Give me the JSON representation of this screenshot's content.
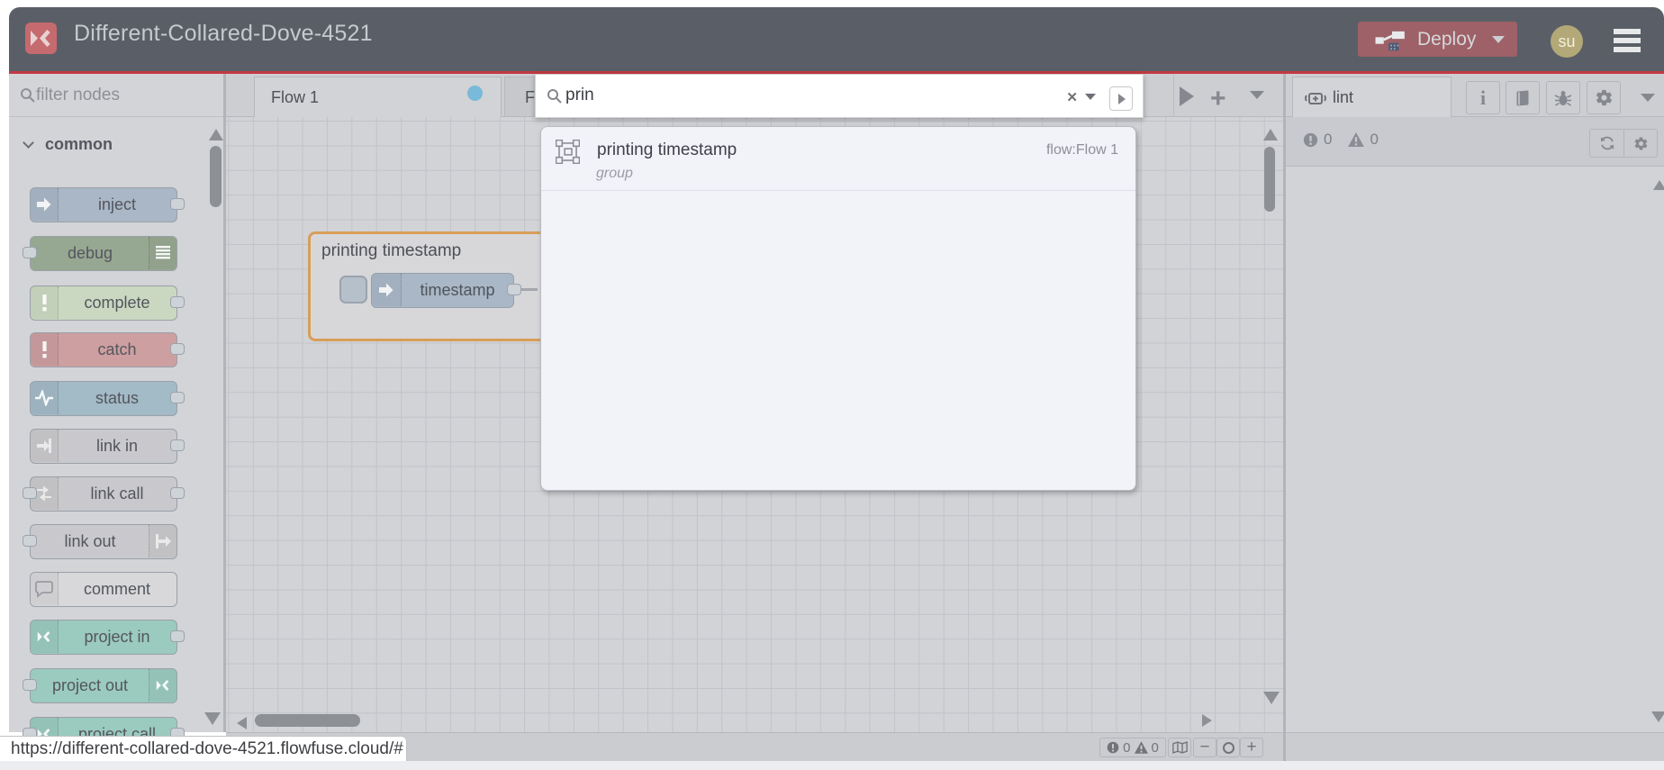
{
  "colors": {
    "header_bg": "#5a5f67",
    "accent_red": "#c23b42",
    "brand_red": "#c56a6e",
    "deploy_bg": "#9d6167",
    "dirty_dot": "#79b9d9",
    "group_border": "#d89e58"
  },
  "header": {
    "title": "Different-Collared-Dove-4521",
    "deploy_label": "Deploy",
    "avatar_initials": "su"
  },
  "workspace": {
    "tab1_label": "Flow 1",
    "tab2_label": "Fl"
  },
  "palette": {
    "filter_placeholder": "filter nodes",
    "category": "common",
    "nodes": [
      {
        "label": "inject",
        "color": "#a9b7c6",
        "icon": "inject-icon",
        "iconSide": "l",
        "ports": "r"
      },
      {
        "label": "debug",
        "color": "#97a892",
        "icon": "debug-icon",
        "iconSide": "r",
        "ports": "l"
      },
      {
        "label": "complete",
        "color": "#cad8c1",
        "icon": "exclamation-icon",
        "iconSide": "l",
        "ports": "r"
      },
      {
        "label": "catch",
        "color": "#cd9fa1",
        "icon": "exclamation-icon",
        "iconSide": "l",
        "ports": "r"
      },
      {
        "label": "status",
        "color": "#a3bac7",
        "icon": "status-icon",
        "iconSide": "l",
        "ports": "r"
      },
      {
        "label": "link in",
        "color": "#c9c9cd",
        "icon": "link-in-icon",
        "iconSide": "l",
        "ports": "r"
      },
      {
        "label": "link call",
        "color": "#c9c9cd",
        "icon": "link-call-icon",
        "iconSide": "l",
        "ports": "lr"
      },
      {
        "label": "link out",
        "color": "#c9c9cd",
        "icon": "link-out-icon",
        "iconSide": "r",
        "ports": "l"
      },
      {
        "label": "comment",
        "color": "#d8d8db",
        "icon": "comment-icon",
        "iconSide": "l",
        "ports": ""
      },
      {
        "label": "project in",
        "color": "#9bcabe",
        "icon": "project-icon",
        "iconSide": "l",
        "ports": "r"
      },
      {
        "label": "project out",
        "color": "#9bcabe",
        "icon": "project-icon",
        "iconSide": "r",
        "ports": "l"
      },
      {
        "label": "project call",
        "color": "#9bcabe",
        "icon": "project-icon",
        "iconSide": "l",
        "ports": "lr"
      }
    ]
  },
  "flow": {
    "group_label": "printing timestamp",
    "node_label": "timestamp"
  },
  "search": {
    "query": "prin",
    "results": [
      {
        "title": "printing timestamp",
        "type": "group",
        "flow": "flow:Flow 1"
      }
    ]
  },
  "sidebar": {
    "tab_label": "lint",
    "error_count": "0",
    "warning_count": "0"
  },
  "canvas_footer": {
    "error_count": "0",
    "warning_count": "0"
  },
  "statusbar": {
    "url": "https://different-collared-dove-4521.flowfuse.cloud/#"
  }
}
